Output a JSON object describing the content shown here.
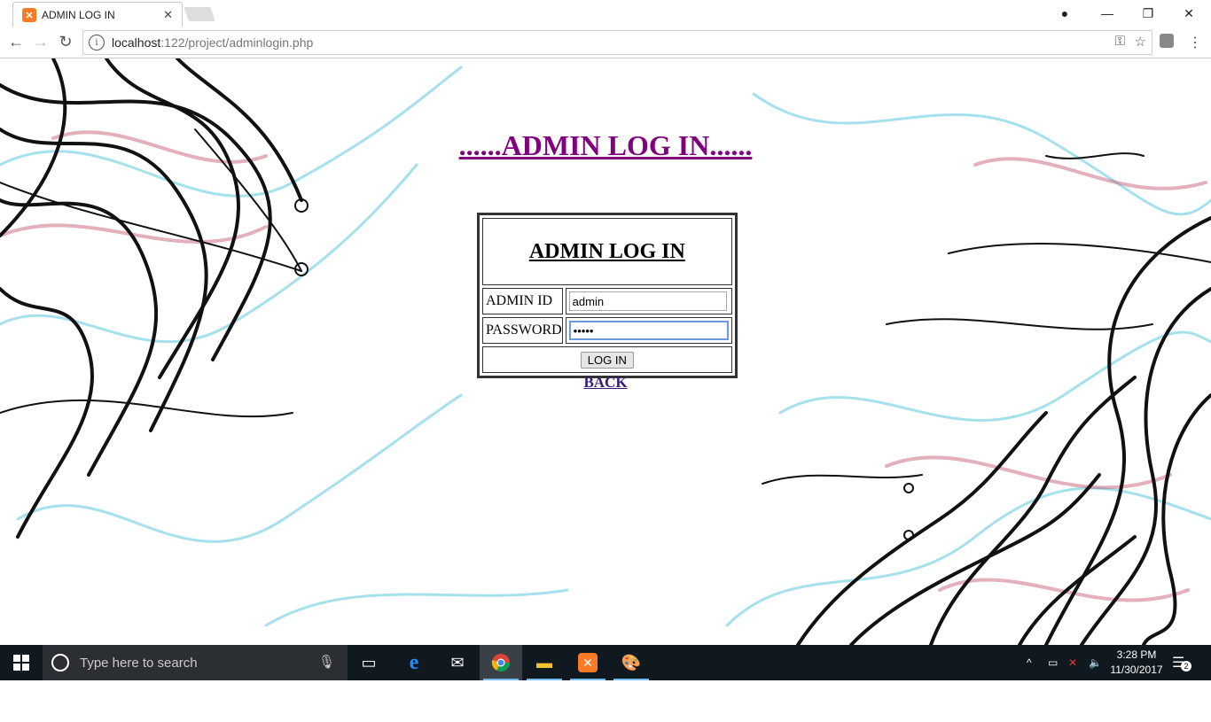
{
  "browser": {
    "tab_title": "ADMIN LOG IN",
    "url_host": "localhost",
    "url_path": ":122/project/adminlogin.php"
  },
  "page": {
    "heading": "......ADMIN LOG IN......",
    "form_title": "ADMIN LOG IN",
    "admin_id_label": "ADMIN ID",
    "admin_id_value": "admin",
    "password_label": "PASSWORD",
    "password_value": "•••••",
    "login_button": "LOG IN",
    "back_link": "BACK"
  },
  "taskbar": {
    "search_placeholder": "Type here to search",
    "time": "3:28 PM",
    "date": "11/30/2017",
    "notification_count": "2"
  },
  "colors": {
    "heading": "#800080",
    "back_link": "#3b1a7a",
    "taskbar": "#101820"
  }
}
